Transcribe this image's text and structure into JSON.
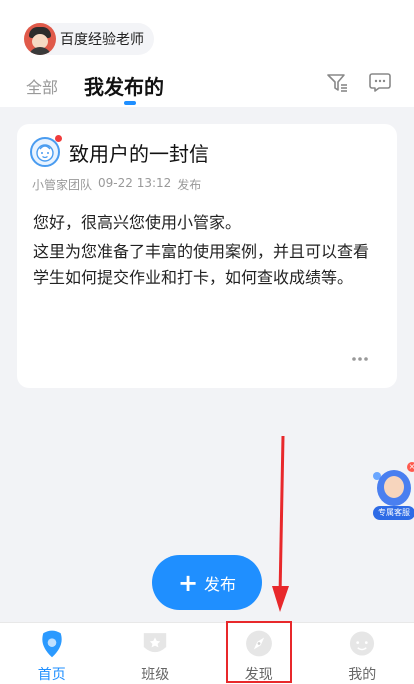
{
  "header": {
    "user_name": "百度经验老师",
    "tabs": [
      {
        "label": "全部",
        "active": false
      },
      {
        "label": "我发布的",
        "active": true
      }
    ],
    "icons": [
      "filter-icon",
      "message-icon"
    ]
  },
  "card": {
    "title": "致用户的一封信",
    "author": "小管家团队",
    "datetime": "09-22 13:12",
    "action": "发布",
    "paragraphs": [
      "您好，很高兴您使用小管家。",
      "这里为您准备了丰富的使用案例，并且可以查看学生如何提交作业和打卡，如何查收成绩等。"
    ],
    "more_icon": "more-icon"
  },
  "float_service": {
    "label": "专属客服",
    "close_glyph": "×"
  },
  "publish_button": {
    "plus": "+",
    "label": "发布"
  },
  "tabbar": {
    "items": [
      {
        "label": "首页",
        "icon": "home-icon",
        "active": true
      },
      {
        "label": "班级",
        "icon": "class-icon",
        "active": false
      },
      {
        "label": "发现",
        "icon": "compass-icon",
        "active": false
      },
      {
        "label": "我的",
        "icon": "profile-icon",
        "active": false
      }
    ]
  },
  "colors": {
    "accent": "#1f8fff",
    "annotation": "#e8282b",
    "background": "#f2f3f6"
  }
}
